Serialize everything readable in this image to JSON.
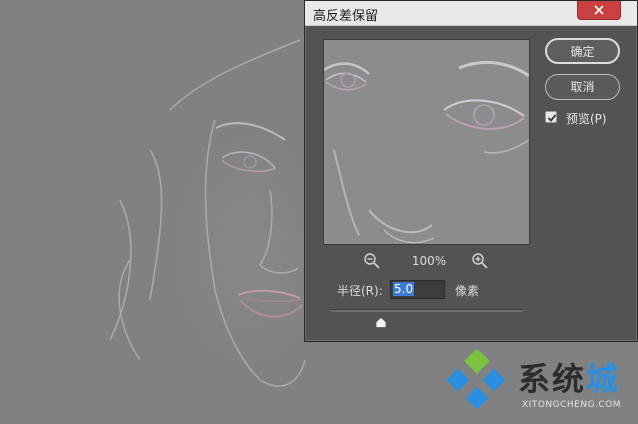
{
  "dialog": {
    "title": "高反差保留",
    "ok_label": "确定",
    "cancel_label": "取消",
    "preview_label": "预览(P)",
    "preview_checked": true,
    "zoom": "100%",
    "radius_label": "半径(R):",
    "radius_value": "5.0",
    "radius_unit": "像素"
  },
  "watermark": {
    "text_part1": "系统",
    "text_part2": "城",
    "sub": "XITONGCHENG.COM"
  },
  "icons": [
    "close-icon",
    "zoom-out-icon",
    "zoom-in-icon",
    "checkmark-icon",
    "slider-thumb-icon",
    "watermark-logo-icon"
  ],
  "colors": {
    "dialog_bg": "#535353",
    "titlebar_bg": "#e9e9e9",
    "close_bg": "#c84040",
    "input_selection": "#3d7bd6",
    "watermark_blue": "#2a8fe0",
    "watermark_green": "#7cc242"
  }
}
